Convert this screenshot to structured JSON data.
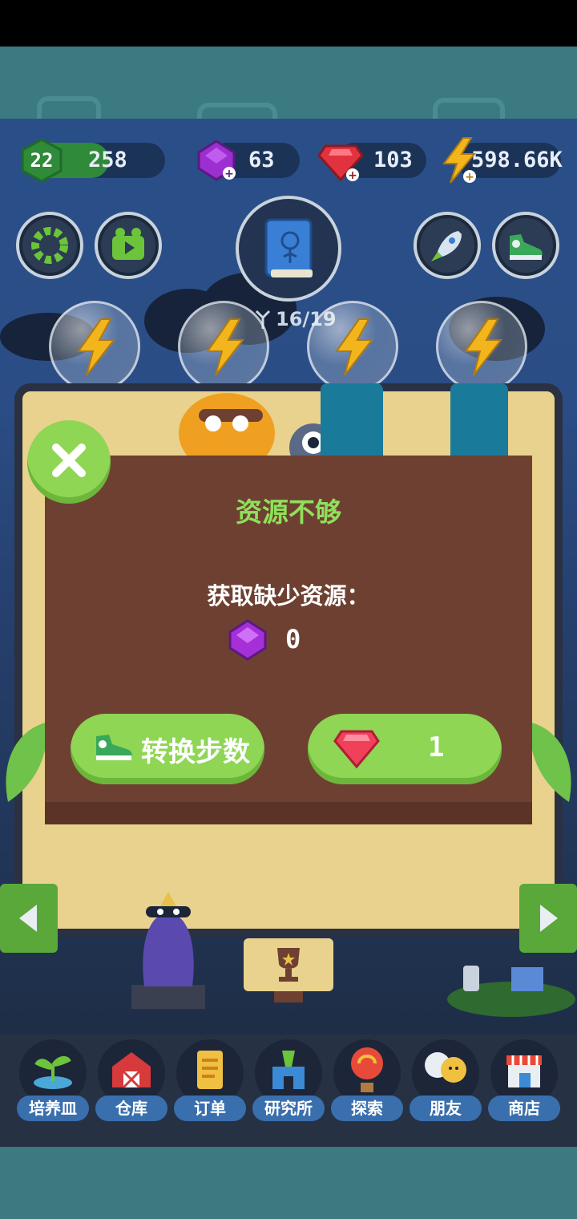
{
  "hud": {
    "level": "22",
    "xp": "258",
    "purple_gems": "63",
    "red_gems": "103",
    "energy": "598.66K"
  },
  "top_buttons": {
    "settings_icon": "gear-icon",
    "video_icon": "video-icon",
    "book_icon": "book-icon",
    "rocket_icon": "rocket-icon",
    "sneaker_icon": "sneaker-icon"
  },
  "collection_progress": "16/19",
  "energy_bubbles": [
    "lightning-icon",
    "lightning-icon",
    "lightning-icon",
    "lightning-icon"
  ],
  "dialog": {
    "title": "资源不够",
    "subtitle": "获取缺少资源：",
    "missing_resource_icon": "purple-gem-icon",
    "missing_amount": "0",
    "convert_label": "转换步数",
    "buy_cost": "1"
  },
  "nav": [
    {
      "label": "培养皿",
      "icon": "sprout-icon"
    },
    {
      "label": "仓库",
      "icon": "barn-icon"
    },
    {
      "label": "订单",
      "icon": "scroll-icon"
    },
    {
      "label": "研究所",
      "icon": "lab-icon"
    },
    {
      "label": "探索",
      "icon": "balloon-icon"
    },
    {
      "label": "朋友",
      "icon": "friends-icon"
    },
    {
      "label": "商店",
      "icon": "shop-icon"
    }
  ],
  "colors": {
    "accent_green": "#8ed654",
    "dialog_brown": "#6e4032",
    "title_green": "#8fe05a",
    "hud_pill": "#1c3358"
  }
}
